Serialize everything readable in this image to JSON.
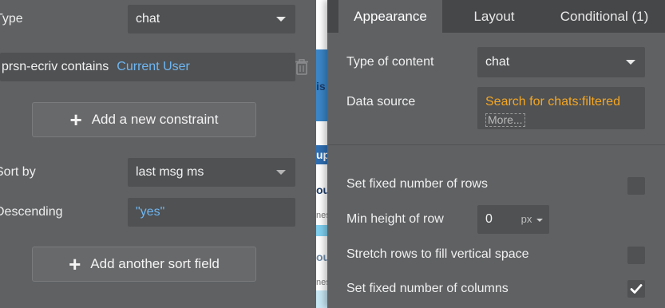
{
  "left": {
    "type_label": "Type",
    "type_value": "chat",
    "constraint_field": "prsn-ecriv contains",
    "constraint_value": "Current User",
    "add_constraint_label": "Add a new constraint",
    "sort_by_label": "Sort by",
    "sort_by_value": "last msg ms",
    "descending_label": "Descending",
    "descending_value": "\"yes\"",
    "add_sort_label": "Add another sort field"
  },
  "strip": {
    "bits": [
      "is",
      "up",
      "ou",
      "nes",
      "ou",
      "nes"
    ]
  },
  "right": {
    "tabs": [
      {
        "label": "Appearance"
      },
      {
        "label": "Layout"
      },
      {
        "label": "Conditional (1)"
      }
    ],
    "type_of_content_label": "Type of content",
    "type_of_content_value": "chat",
    "data_source_label": "Data source",
    "data_source_value": "Search for chats:filtered",
    "data_source_more": "More...",
    "fixed_rows_label": "Set fixed number of rows",
    "fixed_rows_checked": false,
    "min_height_label": "Min height of row",
    "min_height_value": "0",
    "min_height_unit": "px",
    "stretch_rows_label": "Stretch rows to fill vertical space",
    "stretch_rows_checked": false,
    "fixed_columns_label": "Set fixed number of columns",
    "fixed_columns_checked": true
  },
  "colors": {
    "panel_bg": "#5f6163",
    "field_bg": "#4f5153",
    "tab_bar_bg": "#464749",
    "link_blue": "#6eb6f2",
    "accent_orange": "#f5a623"
  }
}
